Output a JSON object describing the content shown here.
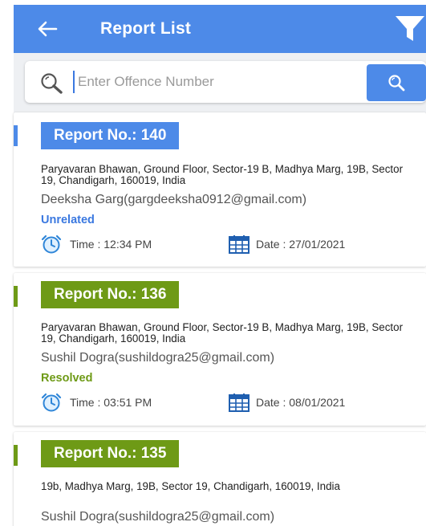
{
  "header": {
    "title": "Report List",
    "color": "#4d8ae8"
  },
  "search": {
    "placeholder": "Enter Offence Number",
    "value": ""
  },
  "colors": {
    "blue": "#4d8ae8",
    "green": "#6e9a16",
    "unrelated": "#3a78e0",
    "resolved": "#6e9a16"
  },
  "reports": [
    {
      "number": "Report No.: 140",
      "address": "Paryavaran Bhawan, Ground Floor, Sector-19 B, Madhya Marg, 19B, Sector 19, Chandigarh, 160019, India",
      "user": "Deeksha Garg(gargdeeksha0912@gmail.com)",
      "status": "Unrelated",
      "time_label": "Time : 12:34 PM",
      "date_label": "Date : 27/01/2021"
    },
    {
      "number": "Report No.: 136",
      "address": "Paryavaran Bhawan, Ground Floor, Sector-19 B, Madhya Marg, 19B, Sector 19, Chandigarh, 160019, India",
      "user": "Sushil Dogra(sushildogra25@gmail.com)",
      "status": "Resolved",
      "time_label": "Time : 03:51 PM",
      "date_label": "Date : 08/01/2021"
    },
    {
      "number": "Report No.: 135",
      "address": "19b, Madhya Marg, 19B, Sector 19, Chandigarh, 160019, India",
      "user": "Sushil Dogra(sushildogra25@gmail.com)",
      "status": "",
      "time_label": "",
      "date_label": ""
    }
  ]
}
